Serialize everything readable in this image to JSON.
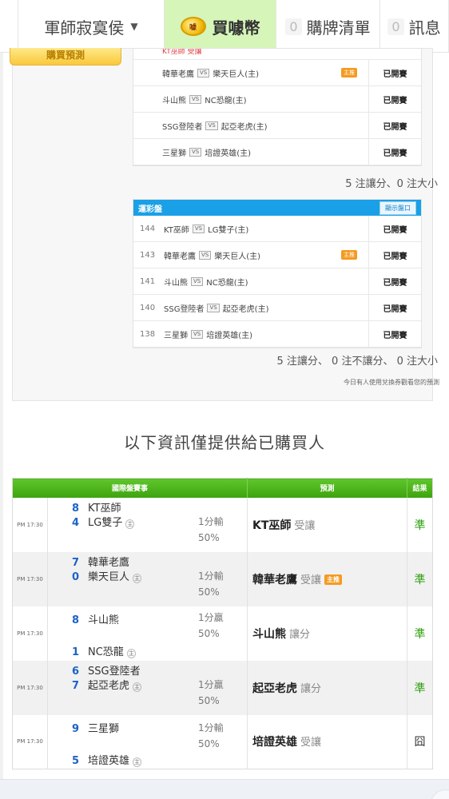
{
  "nav": {
    "user": "軍師寂寞侯",
    "buy_label": "買噱幣",
    "coin_text": "噱",
    "cart_count": "0",
    "cart_label": "購牌清單",
    "msg_count": "0",
    "msg_label": "訊息"
  },
  "left_badge": "購買預測",
  "panel1": {
    "cut_row": "KT巫師  受讓",
    "rows": [
      {
        "home": "韓華老鷹",
        "away": "樂天巨人(主)",
        "tag": "主推",
        "status": "已開賽"
      },
      {
        "home": "斗山熊",
        "away": "NC恐龍(主)",
        "tag": "",
        "status": "已開賽"
      },
      {
        "home": "SSG登陸者",
        "away": "起亞老虎(主)",
        "tag": "",
        "status": "已開賽"
      },
      {
        "home": "三星獅",
        "away": "培證英雄(主)",
        "tag": "",
        "status": "已開賽"
      }
    ],
    "summary": "5 注讓分、0 注大小"
  },
  "panel2": {
    "title": "運彩盤",
    "show_button": "顯示盤口",
    "rows": [
      {
        "num": "144",
        "home": "KT巫師",
        "away": "LG雙子(主)",
        "tag": "",
        "status": "已開賽"
      },
      {
        "num": "143",
        "home": "韓華老鷹",
        "away": "樂天巨人(主)",
        "tag": "主推",
        "status": "已開賽"
      },
      {
        "num": "141",
        "home": "斗山熊",
        "away": "NC恐龍(主)",
        "tag": "",
        "status": "已開賽"
      },
      {
        "num": "140",
        "home": "SSG登陸者",
        "away": "起亞老虎(主)",
        "tag": "",
        "status": "已開賽"
      },
      {
        "num": "138",
        "home": "三星獅",
        "away": "培證英雄(主)",
        "tag": "",
        "status": "已開賽"
      }
    ],
    "summary": "5 注讓分、 0 注不讓分、 0 注大小",
    "note": "今日有人使用兌換券觀看您的預測"
  },
  "vs_text": "VS",
  "section_title": "以下資訊僅提供給已購買人",
  "results": {
    "headers": [
      "國際盤賽事",
      "預測",
      "結果"
    ],
    "home_mark": "主",
    "rows": [
      {
        "time": "PM 17:30",
        "away_score": "8",
        "away": "KT巫師",
        "home_score": "4",
        "home": "LG雙子",
        "spread": "1分輸",
        "pct": "50%",
        "pick": "KT巫師",
        "pick_type": "受讓",
        "pick_tag": "",
        "result": "準"
      },
      {
        "time": "PM 17:30",
        "away_score": "7",
        "away": "韓華老鷹",
        "home_score": "0",
        "home": "樂天巨人",
        "spread": "1分輸",
        "pct": "50%",
        "pick": "韓華老鷹",
        "pick_type": "受讓",
        "pick_tag": "主推",
        "result": "準"
      },
      {
        "time": "PM 17:30",
        "away_score": "8",
        "away": "斗山熊",
        "home_score": "1",
        "home": "NC恐龍",
        "spread": "1分贏",
        "pct": "50%",
        "pick": "斗山熊",
        "pick_type": "讓分",
        "pick_tag": "",
        "result": "準"
      },
      {
        "time": "PM 17:30",
        "away_score": "6",
        "away": "SSG登陸者",
        "home_score": "7",
        "home": "起亞老虎",
        "spread": "1分贏",
        "pct": "50%",
        "pick": "起亞老虎",
        "pick_type": "讓分",
        "pick_tag": "",
        "result": "準"
      },
      {
        "time": "PM 17:30",
        "away_score": "9",
        "away": "三星獅",
        "home_score": "5",
        "home": "培證英雄",
        "spread": "1分輸",
        "pct": "50%",
        "pick": "培證英雄",
        "pick_type": "受讓",
        "pick_tag": "",
        "result": "囧"
      }
    ]
  }
}
